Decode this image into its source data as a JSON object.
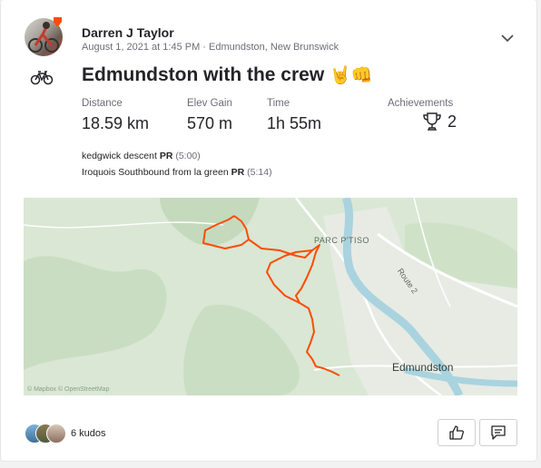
{
  "athlete": {
    "name": "Darren J Taylor"
  },
  "activity": {
    "date_location": "August 1, 2021 at 1:45 PM · Edmundston, New Brunswick",
    "title": "Edmundston with the crew",
    "title_emoji": "🤘👊",
    "sport_icon": "bike-icon"
  },
  "stats": {
    "distance": {
      "label": "Distance",
      "value": "18.59 km"
    },
    "elev_gain": {
      "label": "Elev Gain",
      "value": "570 m"
    },
    "time": {
      "label": "Time",
      "value": "1h 55m"
    },
    "achievements": {
      "label": "Achievements",
      "value": "2"
    }
  },
  "segments": [
    {
      "name": "kedgwick descent",
      "badge": "PR",
      "time": "(5:00)"
    },
    {
      "name": "Iroquois Southbound from la green",
      "badge": "PR",
      "time": "(5:14)"
    }
  ],
  "map": {
    "labels": {
      "park": "PARC P'TISO",
      "road": "Route 2",
      "city": "Edmundston"
    },
    "attribution": "© Mapbox © OpenStreetMap",
    "route_color": "#fc4c02"
  },
  "kudos": {
    "label": "6 kudos"
  },
  "colors": {
    "brand": "#fc4c02",
    "water": "#a9d3df",
    "land": "#d9e7d4"
  }
}
